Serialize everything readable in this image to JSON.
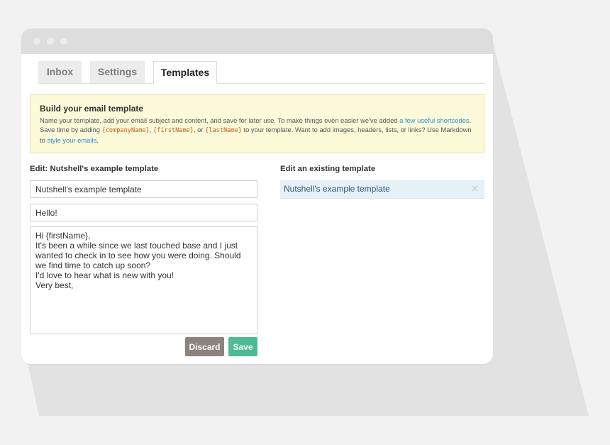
{
  "colors": {
    "page_bg": "#f2f2f2",
    "shadow": "#e2e2e2",
    "titlebar": "#dddddd",
    "link": "#2a8fcf",
    "code": "#c55a17",
    "discard": "#8c837c",
    "save": "#4cbb91"
  },
  "titlebar": {
    "dots": [
      "window-dot",
      "window-dot",
      "window-dot"
    ]
  },
  "tabs": [
    {
      "label": "Inbox",
      "active": false
    },
    {
      "label": "Settings",
      "active": false
    },
    {
      "label": "Templates",
      "active": true
    }
  ],
  "info": {
    "title": "Build your email template",
    "text_1": "Name your template, add your email subject and content, and save for later use. To make things even easier we've added ",
    "link_1": "a few useful shortcodes",
    "text_2": ". Save time by adding ",
    "code_1": "{companyName}",
    "text_3": ", ",
    "code_2": "{firstName}",
    "text_4": ", or ",
    "code_3": "{lastName}",
    "text_5": " to your template. Want to add images, headers, lists, or links? Use Markdown to ",
    "link_2": "style your emails",
    "text_6": "."
  },
  "editor": {
    "label": "Edit: Nutshell's example template",
    "name_value": "Nutshell's example template",
    "subject_value": "Hello!",
    "body_value": "Hi {firstName},\nIt's been a while since we last touched base and I just wanted to check in to see how you were doing. Should we find time to catch up soon?\nI'd love to hear what is new with you!\nVery best,",
    "discard_label": "Discard",
    "save_label": "Save"
  },
  "existing": {
    "label": "Edit an existing template",
    "templates": [
      {
        "name": "Nutshell's example template",
        "remove_icon": "close-icon"
      }
    ]
  }
}
